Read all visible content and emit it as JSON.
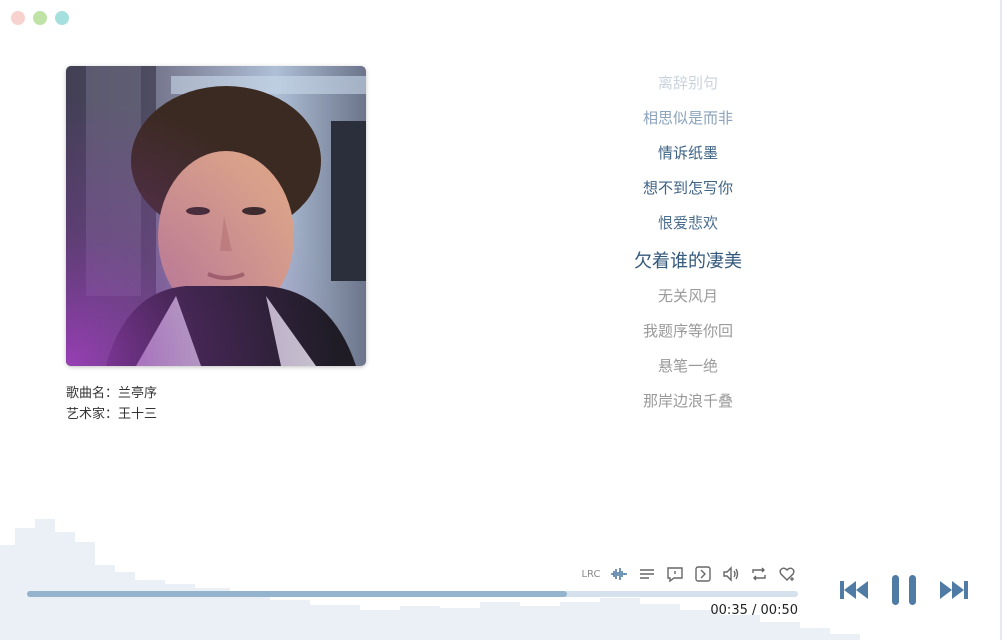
{
  "window": {
    "dot_colors": [
      "#f8d2cf",
      "#bfe3a6",
      "#a6e0de"
    ]
  },
  "song": {
    "title_label": "歌曲名：",
    "title": "兰亭序",
    "artist_label": "艺术家：",
    "artist": "王十三"
  },
  "lyrics": [
    "离辞别句",
    "相思似是而非",
    "情诉纸墨",
    "想不到怎写你",
    "恨爱悲欢",
    "欠着谁的凄美",
    "无关风月",
    "我题序等你回",
    "悬笔一绝",
    "那岸边浪千叠"
  ],
  "current_lyric_index": 5,
  "toolbar": {
    "lrc_label": "LRC",
    "icons": [
      "waveform-icon",
      "playlist-icon",
      "comment-icon",
      "expand-icon",
      "volume-icon",
      "repeat-icon",
      "favorite-icon"
    ]
  },
  "playback": {
    "current_time": "00:35",
    "separator": "/",
    "total_time": "00:50",
    "progress": 0.7
  },
  "colors": {
    "accent": "#4f7ba5",
    "progress_bg": "#d5e1ec",
    "progress_fill": "#94b3cd"
  }
}
